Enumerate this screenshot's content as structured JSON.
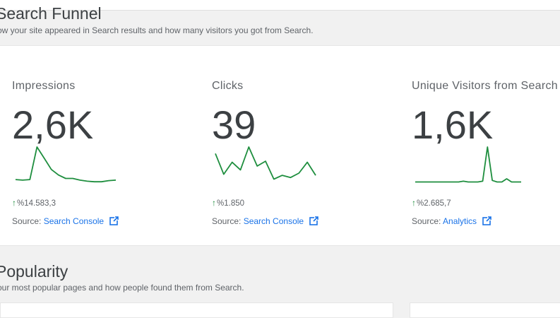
{
  "search_funnel": {
    "title": "Search Funnel",
    "subtitle": "ow your site appeared in Search results and how many visitors you got from Search."
  },
  "metrics": [
    {
      "label": "Impressions",
      "value": "2,6K",
      "change": "%14.583,3",
      "source_prefix": "Source:",
      "source_link": "Search Console",
      "series": [
        10,
        9,
        10,
        68,
        48,
        28,
        18,
        12,
        12,
        9,
        7,
        6,
        6,
        8,
        9
      ]
    },
    {
      "label": "Clicks",
      "value": "39",
      "change": "%1.850",
      "source_prefix": "Source:",
      "source_link": "Search Console",
      "series": [
        58,
        20,
        42,
        28,
        70,
        35,
        44,
        11,
        18,
        14,
        22,
        42,
        18
      ]
    },
    {
      "label": "Unique Visitors from Search",
      "value": "1,6K",
      "change": "%2.685,7",
      "source_prefix": "Source:",
      "source_link": "Analytics",
      "series": [
        4,
        4,
        4,
        4,
        4,
        4,
        4,
        4,
        4,
        4,
        5,
        4,
        4,
        4,
        5,
        48,
        6,
        4,
        4,
        8,
        4,
        4,
        4
      ]
    }
  ],
  "colors": {
    "spark": "#1e8e3e",
    "link": "#1a73e8",
    "trend_up": "#1e8e3e"
  },
  "popularity": {
    "title": "Popularity",
    "subtitle": "our most popular pages and how people found them from Search."
  }
}
